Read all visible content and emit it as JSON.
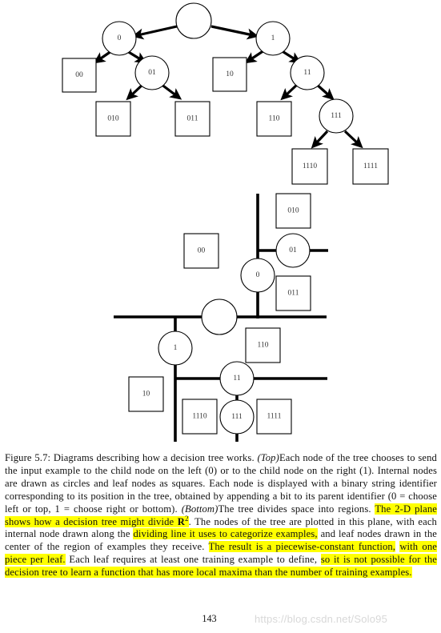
{
  "document": {
    "page_number": "143",
    "watermark": "https://blog.csdn.net/Solo95"
  },
  "figure": {
    "top": {
      "nodes": [
        {
          "id": "root",
          "label": "",
          "type": "circle"
        },
        {
          "id": "n0",
          "label": "0",
          "type": "circle"
        },
        {
          "id": "n1",
          "label": "1",
          "type": "circle"
        },
        {
          "id": "n01",
          "label": "01",
          "type": "circle"
        },
        {
          "id": "n11",
          "label": "11",
          "type": "circle"
        },
        {
          "id": "n111",
          "label": "111",
          "type": "circle"
        },
        {
          "id": "l00",
          "label": "00",
          "type": "square"
        },
        {
          "id": "l10",
          "label": "10",
          "type": "square"
        },
        {
          "id": "l010",
          "label": "010",
          "type": "square"
        },
        {
          "id": "l011",
          "label": "011",
          "type": "square"
        },
        {
          "id": "l110",
          "label": "110",
          "type": "square"
        },
        {
          "id": "l1110",
          "label": "1110",
          "type": "square"
        },
        {
          "id": "l1111",
          "label": "1111",
          "type": "square"
        }
      ]
    },
    "bottom": {
      "nodes": [
        {
          "id": "root",
          "label": "",
          "type": "circle"
        },
        {
          "id": "n0",
          "label": "0",
          "type": "circle"
        },
        {
          "id": "n1",
          "label": "1",
          "type": "circle"
        },
        {
          "id": "n01",
          "label": "01",
          "type": "circle"
        },
        {
          "id": "n11",
          "label": "11",
          "type": "circle"
        },
        {
          "id": "n111",
          "label": "111",
          "type": "circle"
        },
        {
          "id": "l00",
          "label": "00",
          "type": "square"
        },
        {
          "id": "l10",
          "label": "10",
          "type": "square"
        },
        {
          "id": "l010",
          "label": "010",
          "type": "square"
        },
        {
          "id": "l011",
          "label": "011",
          "type": "square"
        },
        {
          "id": "l110",
          "label": "110",
          "type": "square"
        },
        {
          "id": "l1110",
          "label": "1110",
          "type": "square"
        },
        {
          "id": "l1111",
          "label": "1111",
          "type": "square"
        }
      ]
    }
  },
  "caption": {
    "segments": [
      {
        "text": "Figure 5.7: Diagrams describing how a decision tree works. ",
        "style": "normal",
        "highlight": false
      },
      {
        "text": "(Top)",
        "style": "italic",
        "highlight": false
      },
      {
        "text": "Each node of the tree chooses to send the input example to the child node on the left (0) or to the child node on the right (1). Internal nodes are drawn as circles and leaf nodes as squares. Each node is displayed with a binary string identifier corresponding to its position in the tree, obtained by appending a bit to its parent identifier (0 = choose left or top, 1 = choose right or bottom). ",
        "style": "normal",
        "highlight": false
      },
      {
        "text": "(Bottom)",
        "style": "italic",
        "highlight": false
      },
      {
        "text": "The tree divides space into regions. ",
        "style": "normal",
        "highlight": false
      },
      {
        "text": "The 2-D plane shows how a decision tree might divide R2",
        "style": "normal",
        "highlight": true
      },
      {
        "text": ". The nodes of the tree are plotted in this plane, with each internal node drawn along the ",
        "style": "normal",
        "highlight": false
      },
      {
        "text": "dividing line it uses to categorize examples,",
        "style": "normal",
        "highlight": true
      },
      {
        "text": " and leaf nodes drawn in the center of the region of examples they receive. ",
        "style": "normal",
        "highlight": false
      },
      {
        "text": "The result is a piecewise-constant function,",
        "style": "normal",
        "highlight": true
      },
      {
        "text": " ",
        "style": "normal",
        "highlight": false
      },
      {
        "text": "with one piece per leaf.",
        "style": "normal",
        "highlight": true
      },
      {
        "text": " Each leaf requires at least one training example to define, ",
        "style": "normal",
        "highlight": false
      },
      {
        "text": "so it is not possible for the decision tree to learn a function that has more local maxima than the number of training examples.",
        "style": "normal",
        "highlight": true
      }
    ],
    "full_text": "Figure 5.7: Diagrams describing how a decision tree works. (Top)Each node of the tree chooses to send the input example to the child node on the left (0) or to the child node on the right (1). Internal nodes are drawn as circles and leaf nodes as squares. Each node is displayed with a binary string identifier corresponding to its position in the tree, obtained by appending a bit to its parent identifier (0 = choose left or top, 1 = choose right or bottom). (Bottom)The tree divides space into regions. The 2-D plane shows how a decision tree might divide R^2. The nodes of the tree are plotted in this plane, with each internal node drawn along the dividing line it uses to categorize examples, and leaf nodes drawn in the center of the region of examples they receive. The result is a piecewise-constant function, with one piece per leaf. Each leaf requires at least one training example to define, so it is not possible for the decision tree to learn a function that has more local maxima than the number of training examples.",
    "label_prefix": "Figure 5.7:",
    "top_marker": "(Top)",
    "bottom_marker": "(Bottom)"
  },
  "colors": {
    "highlight": "#ffff00",
    "stroke": "#000000",
    "text": "#111111",
    "watermark": "#d8d8d8",
    "background": "#ffffff"
  }
}
